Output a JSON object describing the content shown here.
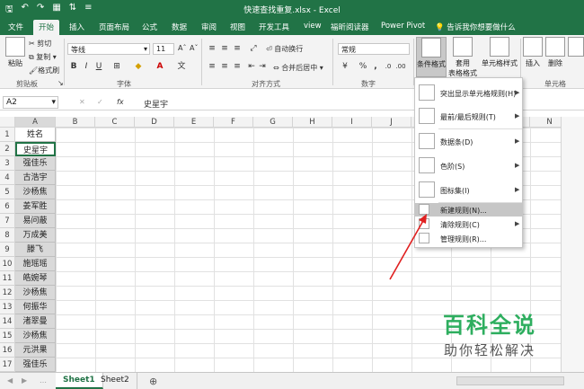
{
  "window": {
    "title": "快速查找重复.xlsx - Excel",
    "qat": [
      "🖫",
      "↶",
      "↷",
      "▦",
      "⇅",
      "≡"
    ]
  },
  "tabs": [
    "文件",
    "开始",
    "插入",
    "页面布局",
    "公式",
    "数据",
    "审阅",
    "视图",
    "开发工具",
    "view",
    "福昕阅读器",
    "Power Pivot",
    "告诉我你想要做什么"
  ],
  "ribbon": {
    "clipboard": {
      "paste": "粘贴",
      "cut": "✂ 剪切",
      "copy": "复制 ▾",
      "painter": "格式刷",
      "label": "剪贴板"
    },
    "font": {
      "name": "等线",
      "size": "11",
      "bold": "B",
      "italic": "I",
      "underline": "U",
      "label": "字体"
    },
    "align": {
      "wrap": "自动换行",
      "merge": "合并后居中 ▾",
      "label": "对齐方式"
    },
    "number": {
      "format": "常规",
      "pct": "%",
      "comma": ",",
      "label": "数字"
    },
    "styles": {
      "cf": "条件格式",
      "table": "套用",
      "table2": "表格格式 ▾",
      "cellstyle": "单元格样式"
    },
    "cells": {
      "insert": "插入",
      "delete": "删除",
      "label": "单元格"
    }
  },
  "formula_bar": {
    "namebox": "A2",
    "fx": "fx",
    "value": "史星宇"
  },
  "columns": [
    "A",
    "B",
    "C",
    "D",
    "E",
    "F",
    "G",
    "H",
    "I",
    "J",
    "K",
    "L",
    "M",
    "N"
  ],
  "rows": [
    "1",
    "2",
    "3",
    "4",
    "5",
    "6",
    "7",
    "8",
    "9",
    "10",
    "11",
    "12",
    "13",
    "14",
    "15",
    "16",
    "17"
  ],
  "column_a": [
    "姓名",
    "史星宇",
    "强佳乐",
    "古浩宇",
    "沙杨焦",
    "姜军胜",
    "易问蔽",
    "万成美",
    "滕飞",
    "施瑶瑶",
    "皓婉琴",
    "沙杨焦",
    "何振华",
    "渚翠曼",
    "沙杨焦",
    "元洪果",
    "强佳乐"
  ],
  "cf_menu": [
    {
      "label": "突出显示单元格规则(H)",
      "sub": true
    },
    {
      "label": "最前/最后规则(T)",
      "sub": true
    },
    {
      "label": "数据条(D)",
      "sub": true
    },
    {
      "label": "色阶(S)",
      "sub": true
    },
    {
      "label": "图标集(I)",
      "sub": true
    },
    {
      "label": "新建规则(N)...",
      "sub": false
    },
    {
      "label": "清除规则(C)",
      "sub": true
    },
    {
      "label": "管理规则(R)...",
      "sub": false
    }
  ],
  "sheets": [
    "Sheet1",
    "Sheet2"
  ],
  "watermark": {
    "line1": "百科全说",
    "line2": "助你轻松解决"
  },
  "colors": {
    "accent": "#217346",
    "arrow": "#e02020"
  }
}
